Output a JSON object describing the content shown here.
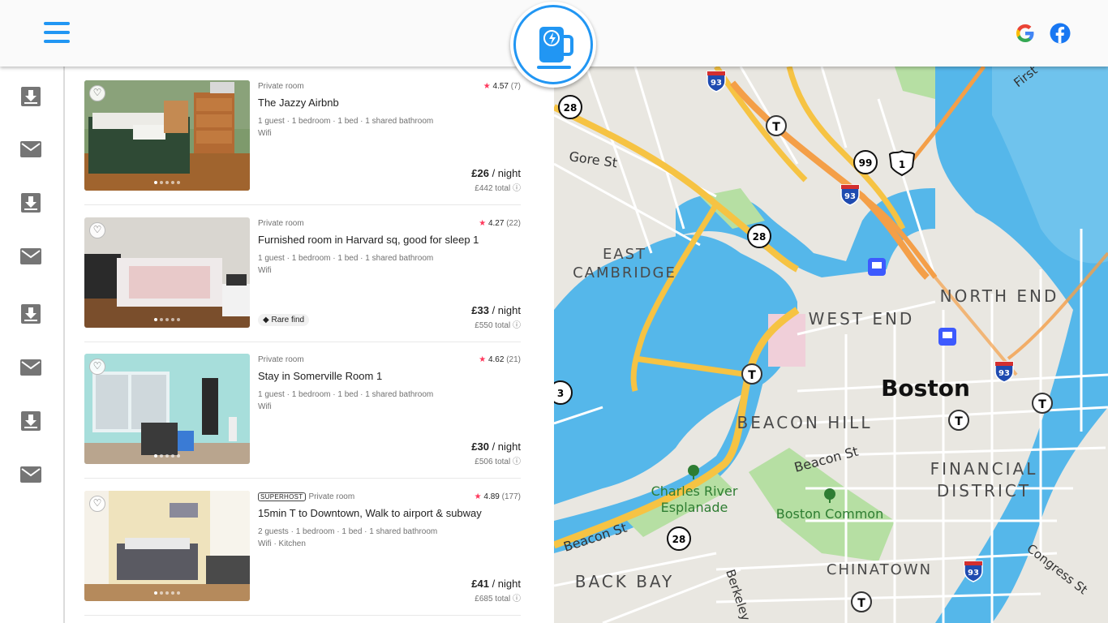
{
  "colors": {
    "accent": "#2196f3",
    "rating_star": "#ff385c",
    "water": "#55b7ea",
    "park": "#b6dfa3",
    "highway": "#f6c343"
  },
  "header": {
    "menu_icon": "hamburger-icon",
    "logo_icon": "charging-mug-icon",
    "social": [
      {
        "icon": "google-icon"
      },
      {
        "icon": "facebook-icon"
      }
    ]
  },
  "sidebar": {
    "items": [
      {
        "icon": "download-icon"
      },
      {
        "icon": "mail-icon"
      },
      {
        "icon": "download-icon"
      },
      {
        "icon": "mail-icon"
      },
      {
        "icon": "download-icon"
      },
      {
        "icon": "mail-icon"
      },
      {
        "icon": "download-icon"
      },
      {
        "icon": "mail-icon"
      }
    ]
  },
  "listings": [
    {
      "type": "Private room",
      "rating": "4.57",
      "reviews": "(7)",
      "title": "The Jazzy Airbnb",
      "details": "1 guest · 1 bedroom · 1 bed · 1 shared bathroom",
      "amenities": "Wifi",
      "price": "£26",
      "per": " / night",
      "total": "£442 total"
    },
    {
      "type": "Private room",
      "rating": "4.27",
      "reviews": "(22)",
      "title": "Furnished room in Harvard sq, good for sleep 1",
      "details": "1 guest · 1 bedroom · 1 bed · 1 shared bathroom",
      "amenities": "Wifi",
      "price": "£33",
      "per": " / night",
      "total": "£550 total",
      "badge": "Rare find"
    },
    {
      "type": "Private room",
      "rating": "4.62",
      "reviews": "(21)",
      "title": "Stay in Somerville Room 1",
      "details": "1 guest · 1 bedroom · 1 bed · 1 shared bathroom",
      "amenities": "Wifi",
      "price": "£30",
      "per": " / night",
      "total": "£506 total"
    },
    {
      "superhost": "SUPERHOST",
      "type": "Private room",
      "rating": "4.89",
      "reviews": "(177)",
      "title": "15min T to Downtown, Walk to airport & subway",
      "details": "2 guests · 1 bedroom · 1 bed · 1 shared bathroom",
      "amenities": "Wifi · Kitchen",
      "price": "£41",
      "per": " / night",
      "total": "£685 total"
    }
  ],
  "map": {
    "labels": {
      "gore_st": "Gore St",
      "east_cambridge_1": "EAST",
      "east_cambridge_2": "CAMBRIDGE",
      "west_end": "WEST END",
      "north_end": "NORTH END",
      "boston": "Boston",
      "beacon_hill": "BEACON HILL",
      "beacon_st_1": "Beacon St",
      "beacon_st_2": "Beacon St",
      "financial_1": "FINANCIAL",
      "financial_2": "DISTRICT",
      "esplanade_1": "Charles River",
      "esplanade_2": "Esplanade",
      "boston_common": "Boston Common",
      "back_bay": "BACK BAY",
      "chinatown": "CHINATOWN",
      "berkeley": "Berkeley",
      "congress_st": "Congress St",
      "first_st": "First"
    },
    "shields": {
      "i93_a": "93",
      "i93_b": "93",
      "i93_c": "93",
      "i93_d": "93",
      "r28_a": "28",
      "r28_b": "28",
      "r28_c": "28",
      "r99": "99",
      "us1": "1",
      "r3": "3"
    },
    "transit_icon": "t-station-icon",
    "train_icon": "train-icon",
    "park_icon": "tree-icon"
  }
}
